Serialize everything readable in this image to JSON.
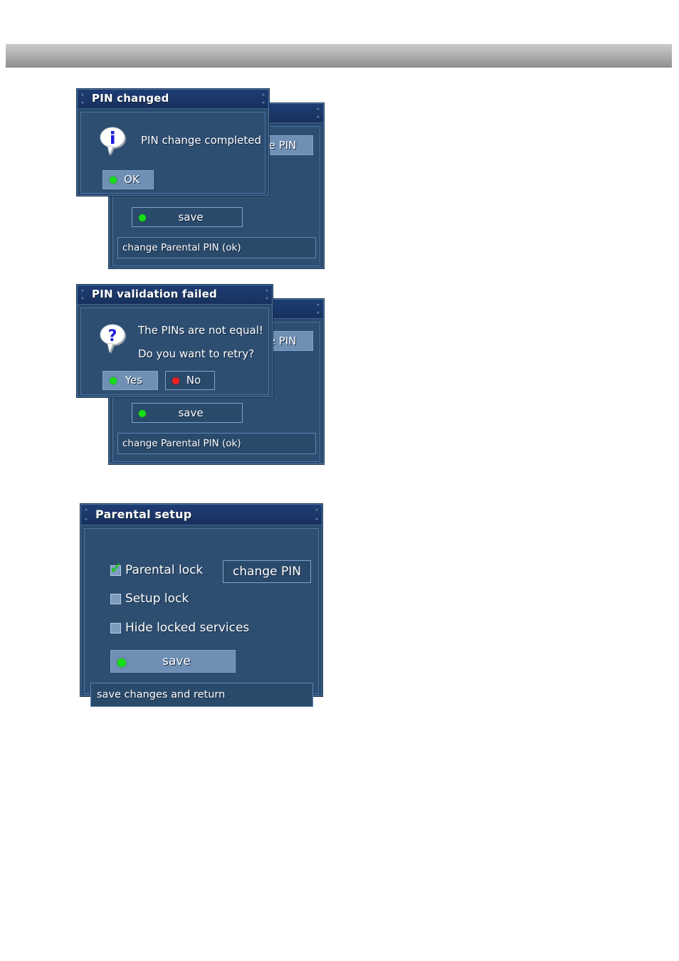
{
  "page": {
    "background_color": "#ffffff",
    "header_bar_color": "#b0b0b0"
  },
  "screens": [
    {
      "id": "pin-changed",
      "dialog": {
        "title": "PIN changed",
        "icon": "info-bubble-icon",
        "message": "PIN change completed",
        "buttons": [
          {
            "label": "OK",
            "dot_color": "#17df17",
            "highlighted": true
          }
        ]
      },
      "background_window": {
        "title": "",
        "change_pin_button": "e PIN",
        "save_button": "save",
        "save_dot_color": "#17df17",
        "status": "change Parental PIN (ok)"
      }
    },
    {
      "id": "pin-validation-failed",
      "dialog": {
        "title": "PIN validation failed",
        "icon": "question-bubble-icon",
        "message_lines": [
          "The PINs are not equal!",
          "Do you want to retry?"
        ],
        "buttons": [
          {
            "label": "Yes",
            "dot_color": "#17df17",
            "highlighted": true
          },
          {
            "label": "No",
            "dot_color": "#f42020",
            "highlighted": false
          }
        ]
      },
      "background_window": {
        "change_pin_button": "e PIN",
        "save_button": "save",
        "save_dot_color": "#17df17",
        "status": "change Parental PIN (ok)"
      }
    },
    {
      "id": "parental-setup",
      "window": {
        "title": "Parental setup",
        "checkboxes": [
          {
            "label": "Parental lock",
            "checked": true,
            "tick": "✓"
          },
          {
            "label": "Setup lock",
            "checked": false,
            "tick": ""
          },
          {
            "label": "Hide locked services",
            "checked": false,
            "tick": ""
          }
        ],
        "change_pin_button": "change PIN",
        "save_button": "save",
        "save_dot_color": "#17df17",
        "status": "save changes and return"
      }
    }
  ]
}
